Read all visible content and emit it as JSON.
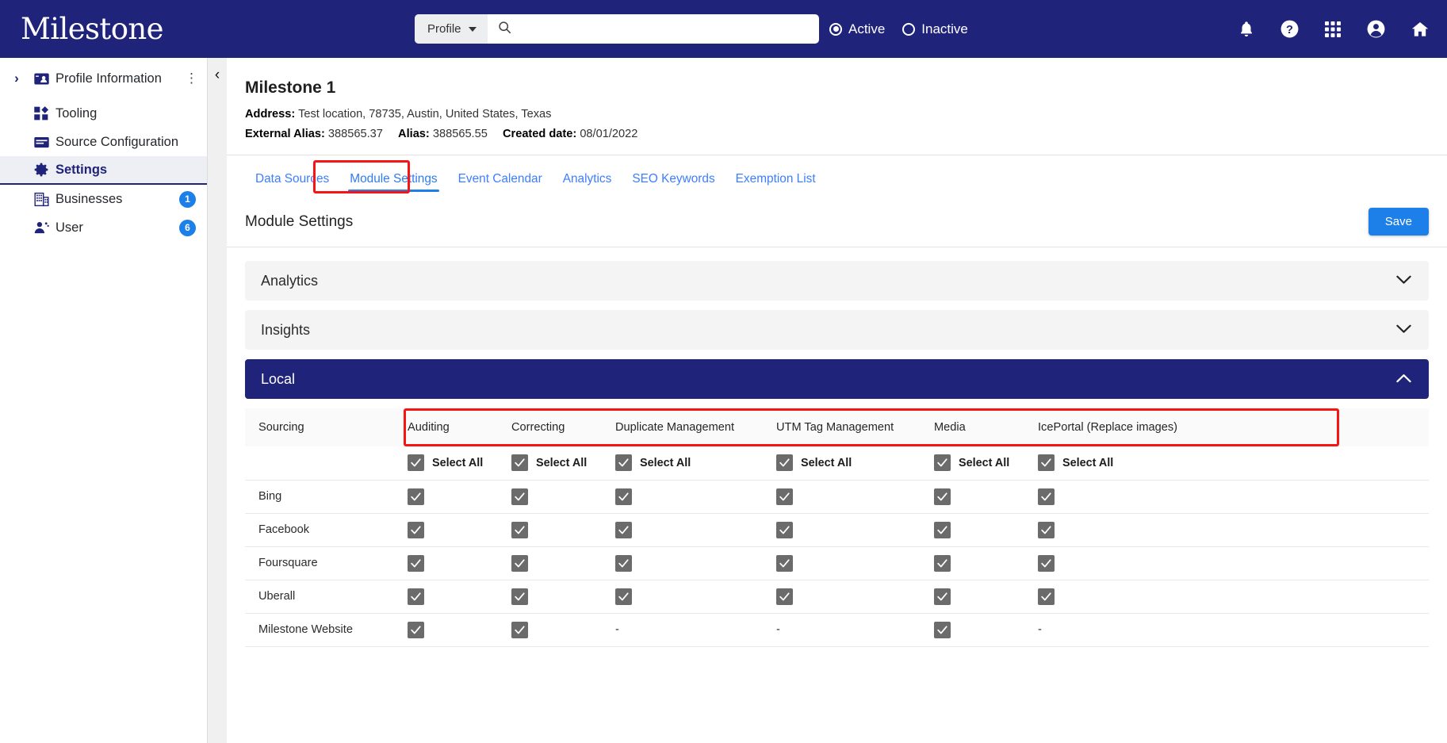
{
  "brand": {
    "logo_text": "Milestone",
    "primary": "#1f2379",
    "accent": "#1d7fe8",
    "annotation": "#f71414"
  },
  "topbar": {
    "search": {
      "scope_label": "Profile",
      "value": "",
      "placeholder": "",
      "icon": "search-icon"
    },
    "status_filter": [
      {
        "label": "Active",
        "selected": true
      },
      {
        "label": "Inactive",
        "selected": false
      }
    ],
    "icons": [
      "bell-icon",
      "help-icon",
      "apps-grid-icon",
      "account-icon",
      "home-icon"
    ]
  },
  "sidebar": {
    "items": [
      {
        "label": "Profile Information",
        "icon": "profile-card-icon",
        "expander": true,
        "kebab": true,
        "badge": "",
        "active": false
      },
      {
        "label": "Tooling",
        "icon": "tooling-icon",
        "expander": false,
        "kebab": false,
        "badge": "",
        "active": false
      },
      {
        "label": "Source Configuration",
        "icon": "source-config-icon",
        "expander": false,
        "kebab": false,
        "badge": "",
        "active": false
      },
      {
        "label": "Settings",
        "icon": "gear-icon",
        "expander": false,
        "kebab": false,
        "badge": "",
        "active": true
      },
      {
        "label": "Businesses",
        "icon": "building-icon",
        "expander": false,
        "kebab": false,
        "badge": "1",
        "active": false
      },
      {
        "label": "User",
        "icon": "user-gear-icon",
        "expander": false,
        "kebab": false,
        "badge": "6",
        "active": false
      }
    ]
  },
  "profile": {
    "name": "Milestone 1",
    "address_label": "Address:",
    "address_value": "Test location, 78735, Austin, United States, Texas",
    "external_alias_label": "External Alias:",
    "external_alias_value": "388565.37",
    "alias_label": "Alias:",
    "alias_value": "388565.55",
    "created_label": "Created date:",
    "created_value": "08/01/2022"
  },
  "tabs": [
    {
      "label": "Data Sources",
      "active": false
    },
    {
      "label": "Module Settings",
      "active": true
    },
    {
      "label": "Event Calendar",
      "active": false
    },
    {
      "label": "Analytics",
      "active": false
    },
    {
      "label": "SEO Keywords",
      "active": false
    },
    {
      "label": "Exemption List",
      "active": false
    }
  ],
  "section": {
    "title": "Module Settings",
    "save_label": "Save"
  },
  "accordions": [
    {
      "title": "Analytics",
      "open": false,
      "chevron": "chevron-down-icon"
    },
    {
      "title": "Insights",
      "open": false,
      "chevron": "chevron-down-icon"
    },
    {
      "title": "Local",
      "open": true,
      "chevron": "chevron-up-icon"
    }
  ],
  "table": {
    "columns": [
      "Sourcing",
      "Auditing",
      "Correcting",
      "Duplicate Management",
      "UTM Tag Management",
      "Media",
      "IcePortal (Replace images)"
    ],
    "select_all_label": "Select All",
    "select_all": [
      true,
      true,
      true,
      true,
      true,
      true
    ],
    "rows": [
      {
        "source": "Bing",
        "cells": [
          "checked",
          "checked",
          "checked",
          "checked",
          "checked",
          "checked"
        ]
      },
      {
        "source": "Facebook",
        "cells": [
          "checked",
          "checked",
          "checked",
          "checked",
          "checked",
          "checked"
        ]
      },
      {
        "source": "Foursquare",
        "cells": [
          "checked",
          "checked",
          "checked",
          "checked",
          "checked",
          "checked"
        ]
      },
      {
        "source": "Uberall",
        "cells": [
          "checked",
          "checked",
          "checked",
          "checked",
          "checked",
          "checked"
        ]
      },
      {
        "source": "Milestone Website",
        "cells": [
          "checked",
          "checked",
          "dash",
          "dash",
          "checked",
          "dash"
        ]
      }
    ],
    "dash_symbol": "-"
  }
}
